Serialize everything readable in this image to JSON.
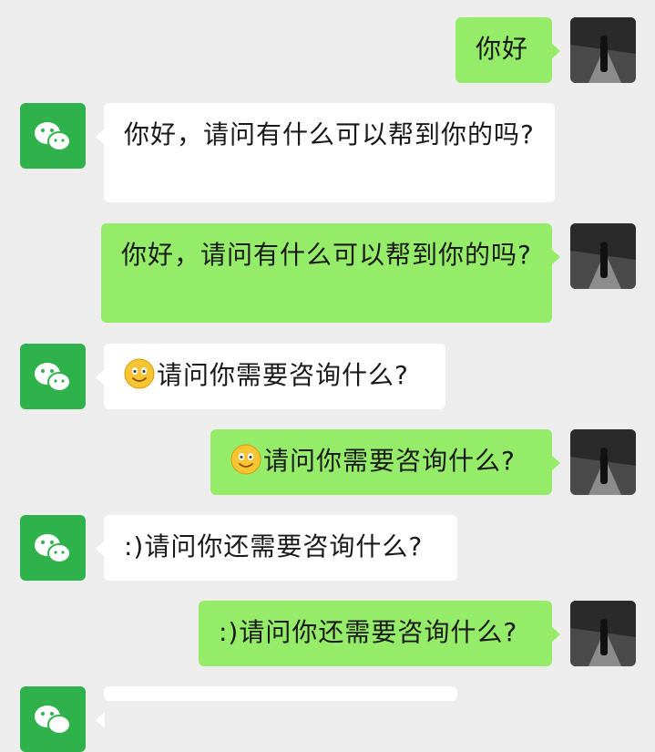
{
  "messages": [
    {
      "sender": "user",
      "text": "你好"
    },
    {
      "sender": "bot",
      "text": "你好，请问有什么可以帮到你的吗?"
    },
    {
      "sender": "user",
      "text": "你好，请问有什么可以帮到你的吗?"
    },
    {
      "sender": "bot",
      "emoji": "smile-emoji",
      "text": "请问你需要咨询什么?"
    },
    {
      "sender": "user",
      "emoji": "smile-emoji",
      "text": "请问你需要咨询什么?"
    },
    {
      "sender": "bot",
      "text": ":)请问你还需要咨询什么?"
    },
    {
      "sender": "user",
      "text": ":)请问你还需要咨询什么?"
    },
    {
      "sender": "bot",
      "text": ""
    }
  ],
  "icons": {
    "bot_avatar": "wechat-icon",
    "user_avatar": "user-photo-avatar"
  },
  "colors": {
    "background": "#ededed",
    "user_bubble": "#95ec69",
    "bot_bubble": "#ffffff",
    "bot_avatar": "#2fb24c"
  }
}
